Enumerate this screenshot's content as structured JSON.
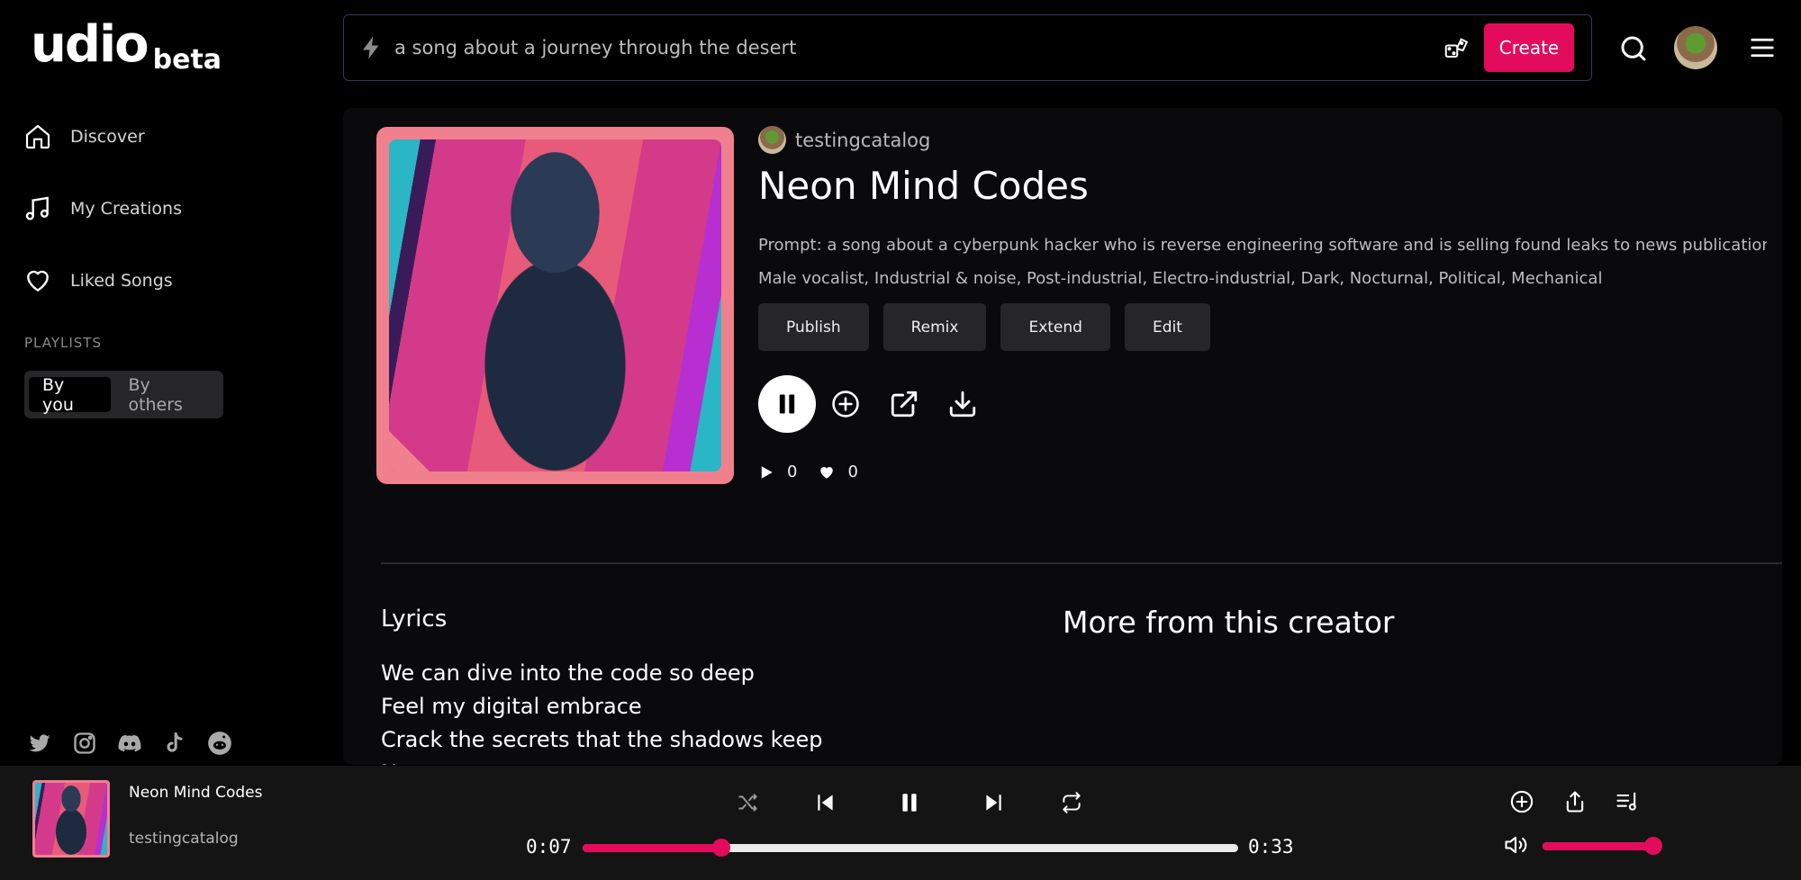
{
  "brand": {
    "name": "udio",
    "tag": "beta"
  },
  "colors": {
    "accent": "#e30b5c",
    "cover_frame": "#f0808e",
    "panel_bg": "#0a0a0c",
    "player_bg": "#141414"
  },
  "sidebar": {
    "items": [
      {
        "label": "Discover",
        "icon": "home-icon"
      },
      {
        "label": "My Creations",
        "icon": "music-note-icon"
      },
      {
        "label": "Liked Songs",
        "icon": "heart-icon"
      }
    ],
    "playlists_heading": "PLAYLISTS",
    "playlist_tabs": [
      {
        "label": "By you",
        "active": true
      },
      {
        "label": "By others",
        "active": false
      }
    ],
    "socials": [
      "twitter-icon",
      "instagram-icon",
      "discord-icon",
      "tiktok-icon",
      "reddit-icon"
    ]
  },
  "topbar": {
    "prompt_placeholder": "a song about a journey through the desert",
    "prompt_value": "",
    "create_label": "Create"
  },
  "song": {
    "creator": "testingcatalog",
    "title": "Neon Mind Codes",
    "prompt": "Prompt: a song about a cyberpunk hacker who is reverse engineering software and is selling found leaks to news publications ,...",
    "tags": "Male vocalist, Industrial & noise, Post-industrial, Electro-industrial, Dark, Nocturnal, Political, Mechanical",
    "actions": [
      "Publish",
      "Remix",
      "Extend",
      "Edit"
    ],
    "plays": "0",
    "likes": "0"
  },
  "lyrics": {
    "heading": "Lyrics",
    "lines": [
      "We can dive into the code so deep",
      "Feel my digital embrace",
      "Crack the secrets that the shadows keep",
      "No…"
    ]
  },
  "more_from_creator": {
    "heading": "More from this creator"
  },
  "player": {
    "title": "Neon Mind Codes",
    "artist": "testingcatalog",
    "elapsed": "0:07",
    "duration": "0:33",
    "progress_fraction": 0.2121,
    "volume_fraction": 1.0,
    "state": "playing"
  }
}
